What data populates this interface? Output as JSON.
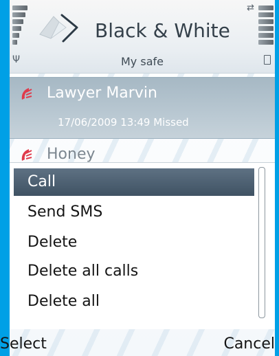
{
  "app": {
    "title": "Black & White",
    "subtitle": "My safe"
  },
  "list": {
    "items": [
      {
        "name": "Lawyer Marvin",
        "detail": "17/06/2009 13:49 Missed",
        "selected": true
      },
      {
        "name": "Honey",
        "detail": "",
        "selected": false
      }
    ]
  },
  "menu": {
    "items": [
      {
        "label": "Call",
        "selected": true
      },
      {
        "label": "Send SMS",
        "selected": false
      },
      {
        "label": "Delete",
        "selected": false
      },
      {
        "label": "Delete all calls",
        "selected": false
      },
      {
        "label": "Delete all",
        "selected": false
      }
    ]
  },
  "softkeys": {
    "left": "Select",
    "right": "Cancel"
  },
  "colors": {
    "frame": "#00a0e6",
    "highlight": "#a6b8c4",
    "menu_selected": "#4e6173",
    "missed_call_icon": "#e03a4b"
  },
  "icons": {
    "signal": "signal-strength-icon",
    "battery": "battery-level-icon",
    "app": "black-white-app-icon",
    "antenna": "antenna-icon",
    "data": "data-connection-icon",
    "lock": "lock-icon",
    "call": "missed-call-icon"
  }
}
